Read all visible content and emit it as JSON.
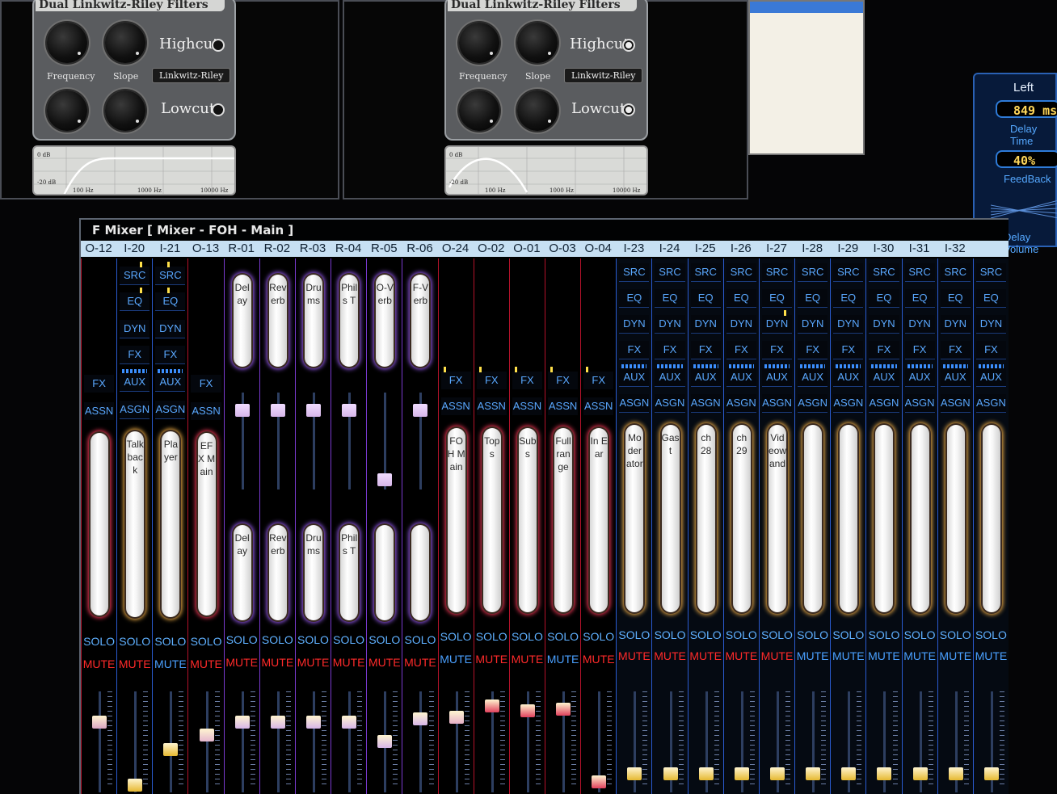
{
  "filters": [
    {
      "title": "Dual Linkwitz-Riley Filters",
      "highcut": "Highcut",
      "lowcut": "Lowcut",
      "frequency": "Frequency",
      "slope": "Slope",
      "type": "Linkwitz-Riley",
      "db_top": "0 dB",
      "db_bottom": "-20 dB",
      "f1": "100 Hz",
      "f2": "1000 Hz",
      "f3": "10000 Hz"
    },
    {
      "title": "Dual Linkwitz-Riley Filters",
      "highcut": "Highcut",
      "lowcut": "Lowcut",
      "frequency": "Frequency",
      "slope": "Slope",
      "type": "Linkwitz-Riley",
      "db_top": "0 dB",
      "db_bottom": "-20 dB",
      "f1": "100 Hz",
      "f2": "1000 Hz",
      "f3": "10000 Hz"
    }
  ],
  "delay": {
    "header": "Left",
    "time": "849 ms",
    "time_label": "Delay Time",
    "feedback": "40%",
    "feedback_label": "FeedBack",
    "volume_label": "Delay Volume"
  },
  "mixer": {
    "title": "F Mixer  [ Mixer - FOH - Main ]",
    "buttons": {
      "src": "SRC",
      "eq": "EQ",
      "dyn": "DYN",
      "fx": "FX",
      "aux": "AUX",
      "asgn": "ASGN",
      "assn": "ASSN",
      "solo": "SOLO",
      "mute": "MUTE"
    },
    "channels": [
      {
        "id": "O-12",
        "kind": "out",
        "label": "",
        "mute_color": "#ff2a2a",
        "cap": "#d9a5c2"
      },
      {
        "id": "I-20",
        "kind": "in2",
        "label": "Talkback",
        "mute_color": "#ff2a2a",
        "cap": "#e6b830"
      },
      {
        "id": "I-21",
        "kind": "in2",
        "label": "Player",
        "mute_color": "#4aa0ff",
        "cap": "#e6b830"
      },
      {
        "id": "O-13",
        "kind": "out",
        "label": "EFX Main",
        "mute_color": "#ff2a2a",
        "cap": "#e6b7cf"
      },
      {
        "id": "R-01",
        "kind": "ret",
        "label": "Delay",
        "label2": "Delay",
        "mute_color": "#ff2a2a",
        "cap": "#d7b6e9"
      },
      {
        "id": "R-02",
        "kind": "ret",
        "label": "Reverb",
        "label2": "Reverb",
        "mute_color": "#ff2a2a",
        "cap": "#d7b6e9"
      },
      {
        "id": "R-03",
        "kind": "ret",
        "label": "Drums",
        "label2": "Drums",
        "mute_color": "#ff2a2a",
        "cap": "#d7b6e9"
      },
      {
        "id": "R-04",
        "kind": "ret",
        "label": "Phils T",
        "label2": "Phils T",
        "mute_color": "#ff2a2a",
        "cap": "#d7b6e9"
      },
      {
        "id": "R-05",
        "kind": "ret",
        "label": "O-Verb",
        "label2": "",
        "mute_color": "#ff2a2a",
        "cap": "#d7b6e9"
      },
      {
        "id": "R-06",
        "kind": "ret",
        "label": "F-Verb",
        "label2": "",
        "mute_color": "#ff2a2a",
        "cap": "#d7b6e9"
      },
      {
        "id": "O-24",
        "kind": "out",
        "label": "FOH Main",
        "mute_color": "#4aa0ff",
        "cap": "#e6b0c8"
      },
      {
        "id": "O-02",
        "kind": "out",
        "label": "Tops",
        "mute_color": "#ff2a2a",
        "cap": "#e0405c"
      },
      {
        "id": "O-01",
        "kind": "out",
        "label": "Subs",
        "mute_color": "#ff2a2a",
        "cap": "#e0405c"
      },
      {
        "id": "O-03",
        "kind": "out",
        "label": "Fullrange",
        "mute_color": "#4aa0ff",
        "cap": "#e0405c"
      },
      {
        "id": "O-04",
        "kind": "out",
        "label": "In Ear",
        "mute_color": "#ff2a2a",
        "cap": "#e0405c"
      },
      {
        "id": "I-23",
        "kind": "in",
        "label": "Moderator",
        "mute_color": "#ff2a2a",
        "cap": "#e6b830"
      },
      {
        "id": "I-24",
        "kind": "in",
        "label": "Gast",
        "mute_color": "#ff2a2a",
        "cap": "#e6b830"
      },
      {
        "id": "I-25",
        "kind": "in",
        "label": "ch 28",
        "mute_color": "#ff2a2a",
        "cap": "#e6b830"
      },
      {
        "id": "I-26",
        "kind": "in",
        "label": "ch 29",
        "mute_color": "#ff2a2a",
        "cap": "#e6b830"
      },
      {
        "id": "I-27",
        "kind": "in",
        "label": "Videowand",
        "mute_color": "#ff2a2a",
        "cap": "#e6b830"
      },
      {
        "id": "I-28",
        "kind": "in",
        "label": "",
        "mute_color": "#4aa0ff",
        "cap": "#e6b830"
      },
      {
        "id": "I-29",
        "kind": "in",
        "label": "",
        "mute_color": "#4aa0ff",
        "cap": "#e6b830"
      },
      {
        "id": "I-30",
        "kind": "in",
        "label": "",
        "mute_color": "#4aa0ff",
        "cap": "#e6b830"
      },
      {
        "id": "I-31",
        "kind": "in",
        "label": "",
        "mute_color": "#4aa0ff",
        "cap": "#e6b830"
      },
      {
        "id": "I-32",
        "kind": "in",
        "label": "",
        "mute_color": "#4aa0ff",
        "cap": "#e6b830"
      },
      {
        "id": "",
        "kind": "in",
        "label": "",
        "mute_color": "#4aa0ff",
        "cap": "#e6b830"
      }
    ]
  }
}
